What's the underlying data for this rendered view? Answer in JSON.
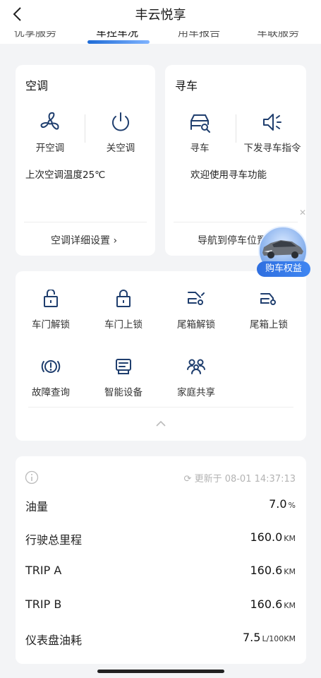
{
  "header": {
    "title": "丰云悦享"
  },
  "tabs": [
    {
      "label": "优享服务"
    },
    {
      "label": "车控车况"
    },
    {
      "label": "用车报告"
    },
    {
      "label": "车联服务"
    }
  ],
  "ac_card": {
    "title": "空调",
    "on_label": "开空调",
    "off_label": "关空调",
    "last_temp": "上次空调温度25℃",
    "detail_link": "空调详细设置"
  },
  "find_card": {
    "title": "寻车",
    "find_label": "寻车",
    "send_label": "下发寻车指令",
    "welcome": "欢迎使用寻车功能",
    "nav_link": "导航到停车位置"
  },
  "promo": {
    "label": "购车权益"
  },
  "controls": [
    {
      "label": "车门解锁"
    },
    {
      "label": "车门上锁"
    },
    {
      "label": "尾箱解锁"
    },
    {
      "label": "尾箱上锁"
    },
    {
      "label": "故障查询"
    },
    {
      "label": "智能设备"
    },
    {
      "label": "家庭共享"
    }
  ],
  "status": {
    "update_text": "更新于 08-01 14:37:13",
    "rows": [
      {
        "label": "油量",
        "value": "7.0",
        "unit": "%"
      },
      {
        "label": "行驶总里程",
        "value": "160.0",
        "unit": "KM"
      },
      {
        "label": "TRIP A",
        "value": "160.6",
        "unit": "KM"
      },
      {
        "label": "TRIP B",
        "value": "160.6",
        "unit": "KM"
      },
      {
        "label": "仪表盘油耗",
        "value": "7.5",
        "unit": "L/100KM"
      }
    ]
  },
  "colors": {
    "accent": "#1e6bd6",
    "icon": "#1f3e6e"
  }
}
